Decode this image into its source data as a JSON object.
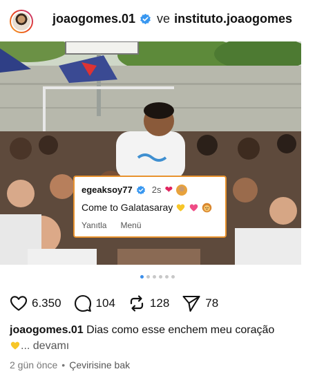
{
  "header": {
    "username": "joaogomes.01",
    "and_word": "ve",
    "collaborator": "instituto.joaogomes"
  },
  "comment": {
    "username": "egeaksoy77",
    "time": "2s",
    "text": "Come to Galatasaray",
    "reply_label": "Yanıtla",
    "menu_label": "Menü"
  },
  "carousel": {
    "total_dots": 6,
    "active_index": 0
  },
  "actions": {
    "likes": "6.350",
    "comments": "104",
    "reposts": "128",
    "shares": "78"
  },
  "caption": {
    "username": "joaogomes.01",
    "text": "Dias como esse enchem meu coração",
    "more": "... devamı"
  },
  "meta": {
    "time_ago": "2 gün önce",
    "separator": "•",
    "translate": "Çevirisine bak"
  },
  "colors": {
    "verified_blue": "#3897f0",
    "heart_red": "#e0245e",
    "comment_border": "#e8922d",
    "dot_active": "#3b8eea"
  },
  "icons": {
    "like": "heart-outline-icon",
    "comment": "comment-bubble-icon",
    "repost": "repost-icon",
    "share": "paper-plane-icon",
    "verified": "verified-badge-icon"
  }
}
